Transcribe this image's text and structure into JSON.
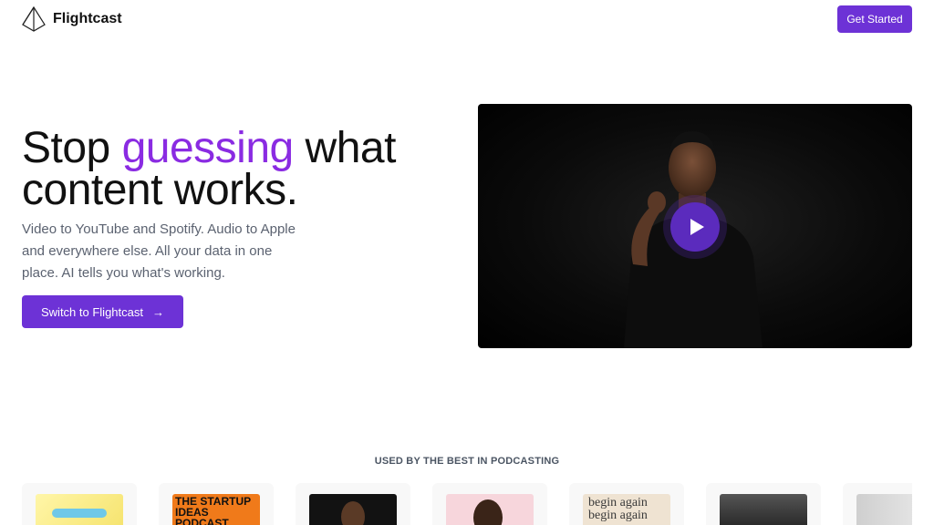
{
  "brand": {
    "name": "Flightcast"
  },
  "nav": {
    "cta_label": "Get Started"
  },
  "hero": {
    "title_before": "Stop ",
    "title_highlight": "guessing",
    "title_after": " what content works.",
    "subtitle": "Video to YouTube and Spotify. Audio to Apple and everywhere else. All your data in one place. AI tells you what's working.",
    "cta_label": "Switch to Flightcast",
    "cta_arrow": "→"
  },
  "social_proof": {
    "heading": "USED BY THE BEST IN PODCASTING",
    "covers": [
      {
        "name": "cover-yellow",
        "text": ""
      },
      {
        "name": "cover-startup-ideas",
        "text": "THE STARTUP IDEAS PODCAST"
      },
      {
        "name": "cover-dark-portrait",
        "text": ""
      },
      {
        "name": "cover-pink-portrait",
        "text": ""
      },
      {
        "name": "cover-begin-again",
        "text": "begin again begin again"
      },
      {
        "name": "cover-dark-gradient",
        "text": ""
      },
      {
        "name": "cover-grey",
        "text": ""
      }
    ]
  },
  "colors": {
    "accent": "#6d32d6",
    "highlight": "#8a2be2",
    "subtitle": "#5b6270"
  }
}
